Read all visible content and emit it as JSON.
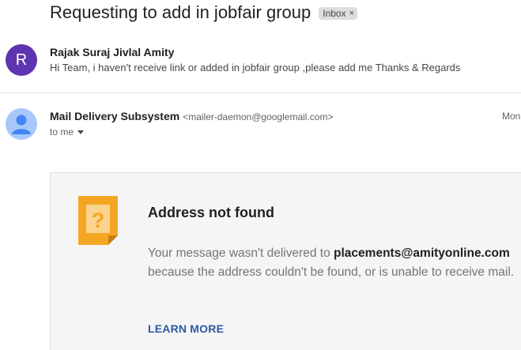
{
  "thread": {
    "subject": "Requesting to add in jobfair group",
    "label_chip": "Inbox",
    "label_chip_remove": "×"
  },
  "messages": [
    {
      "avatar_letter": "R",
      "avatar_color": "#5e35b1",
      "sender_name": "Rajak Suraj Jivlal Amity",
      "snippet": "Hi Team, i haven't receive link or added in jobfair group ,please add me Thanks & Regards"
    },
    {
      "avatar_icon": "default-person-icon",
      "sender_name": "Mail Delivery Subsystem",
      "sender_email": "<mailer-daemon@googlemail.com>",
      "date": "Mon",
      "recipient": "to me"
    }
  ],
  "bounce": {
    "icon": "question-mark-note-icon",
    "icon_color": "#f4a623",
    "title": "Address not found",
    "body_before": "Your message wasn't delivered to ",
    "address": "placements@amityonline.com",
    "body_after": " because the address couldn't be found, or is unable to receive mail.",
    "learn_more": "LEARN MORE",
    "link_color": "#2b5aa5"
  }
}
